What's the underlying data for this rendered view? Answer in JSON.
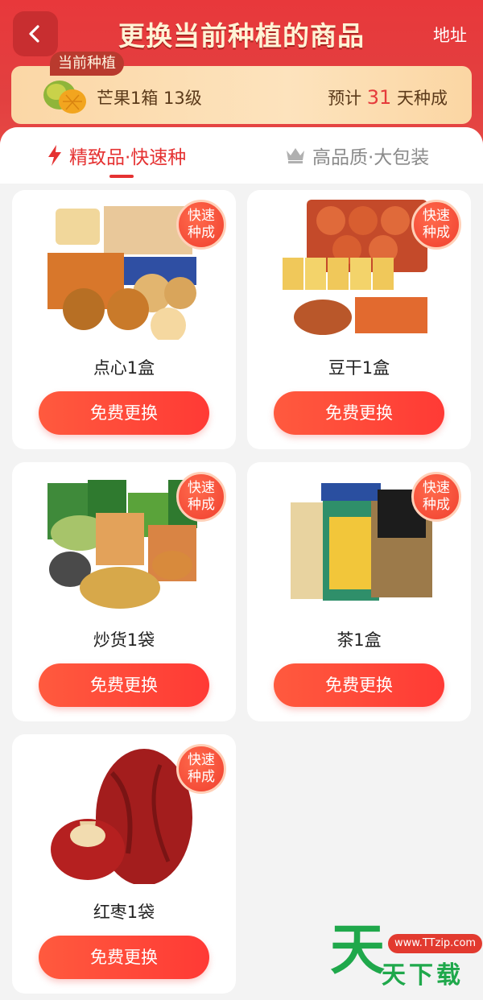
{
  "header": {
    "title": "更换当前种植的商品",
    "address": "地址"
  },
  "current": {
    "tag": "当前种植",
    "name": "芒果1箱 13级",
    "eta_prefix": "预计",
    "eta_days": "31",
    "eta_suffix": "天种成"
  },
  "tabs": [
    {
      "label": "精致品·快速种",
      "icon": "lightning-icon"
    },
    {
      "label": "高品质·大包装",
      "icon": "crown-icon"
    }
  ],
  "badge": {
    "line1": "快速",
    "line2": "种成"
  },
  "button_label": "免费更换",
  "items": [
    {
      "name": "点心1盒"
    },
    {
      "name": "豆干1盒"
    },
    {
      "name": "炒货1袋"
    },
    {
      "name": "茶1盒"
    },
    {
      "name": "红枣1袋"
    }
  ],
  "watermark": {
    "url": "www.TTzip.com",
    "big": "天",
    "small": "天下载"
  },
  "colors": {
    "header_red": "#e8383b",
    "accent_red": "#e53232",
    "button_red": "#ff3a35",
    "watermark_green": "#1fa84b"
  }
}
